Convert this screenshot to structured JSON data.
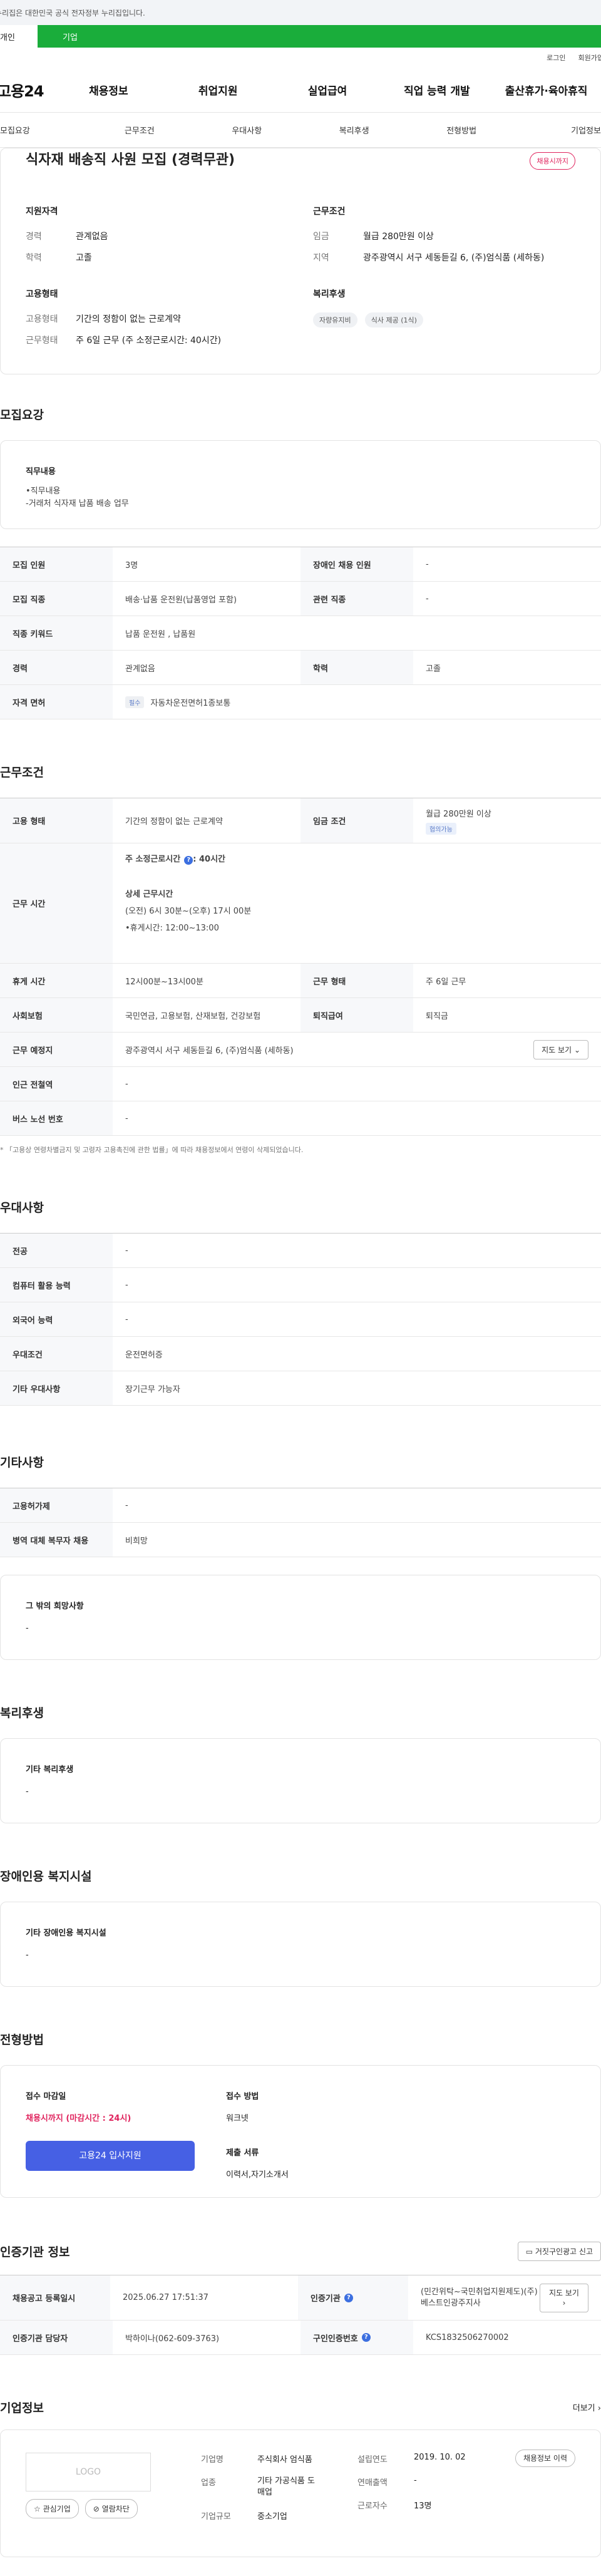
{
  "topbar": {
    "notice": "누리집은 대한민국 공식 전자정부 누리집입니다."
  },
  "tabs": {
    "person": "개인",
    "biz": "기업"
  },
  "util": {
    "login": "로그인",
    "join": "회원가입"
  },
  "gnb": {
    "logo": "고용24",
    "items": [
      "채용정보",
      "취업지원",
      "실업급여",
      "직업 능력 개발",
      "출산휴가·육아휴직"
    ]
  },
  "subnav": [
    "모집요강",
    "근무조건",
    "우대사항",
    "복리후생",
    "전형방법",
    "기업정보"
  ],
  "summary": {
    "title": "식자재 배송직 사원 모집 (경력무관)",
    "badge": "채용시까지",
    "qual": {
      "heading": "지원자격",
      "career_k": "경력",
      "career_v": "관계없음",
      "edu_k": "학력",
      "edu_v": "고졸"
    },
    "emp": {
      "heading": "고용형태",
      "type_k": "고용형태",
      "type_v": "기간의 정함이 없는 근로계약",
      "work_k": "근무형태",
      "work_v": "주 6일 근무 (주 소정근로시간: 40시간)"
    },
    "cond": {
      "heading": "근무조건",
      "wage_k": "임금",
      "wage_v": "월급 280만원 이상",
      "area_k": "지역",
      "area_v": "광주광역시 서구 세동듣길 6, (주)엄식품 (세하동)"
    },
    "welfare": {
      "heading": "복리후생",
      "chips": [
        "자량유지비",
        "식사 제공 (1식)"
      ]
    }
  },
  "recruit": {
    "heading": "모집요강",
    "job_heading": "직무내용",
    "job_lines": [
      "•직무내용",
      "-거래처 식자재 납품 배송 업무"
    ],
    "rows": {
      "count_k": "모집 인원",
      "count_v": "3명",
      "disabled_k": "장애인 채용 인원",
      "disabled_v": "-",
      "job_k": "모집 직종",
      "job_v": "배송·납품 운전원(납품영업 포함)",
      "rel_k": "관련 직종",
      "rel_v": "-",
      "kw_k": "직종 키워드",
      "kw_v": "납품 운전원 , 납품원",
      "career_k": "경력",
      "career_v": "관계없음",
      "edu_k": "학력",
      "edu_v": "고졸",
      "lic_k": "자격 면허",
      "lic_tag": "필수",
      "lic_v": "자동차운전면허1종보통"
    }
  },
  "work": {
    "heading": "근무조건",
    "type_k": "고용 형태",
    "type_v": "기간의 정함이 없는 근로계약",
    "wage_k": "임금 조건",
    "wage_v": "월급 280만원 이상",
    "wage_tag": "협의가능",
    "time_k": "근무 시간",
    "time_total": "주 소정근로시간",
    "time_hours": ": 40시간",
    "time_detail_h": "상세 근무시간",
    "time_detail_1": "(오전) 6시 30분~(오후) 17시 00분",
    "time_detail_2": "•휴게시간: 12:00~13:00",
    "rest_k": "휴게 시간",
    "rest_v": "12시00분~13시00분",
    "form_k": "근무 형태",
    "form_v": "주 6일 근무",
    "ins_k": "사회보험",
    "ins_v": "국민연금, 고용보험, 산재보험, 건강보험",
    "sev_k": "퇴직급여",
    "sev_v": "퇴직금",
    "place_k": "근무 예정지",
    "place_v": "광주광역시 서구 세동듣길 6, (주)엄식품 (세하동)",
    "map_btn": "지도 보기",
    "subway_k": "인근 전철역",
    "subway_v": "-",
    "bus_k": "버스 노선 번호",
    "bus_v": "-",
    "note": "* 「고용상 연령차별금지 및 고령자 고용촉진에 관한 법률」에 따라 채용정보에서 연령이 삭제되었습니다."
  },
  "pref": {
    "heading": "우대사항",
    "major_k": "전공",
    "major_v": "-",
    "pc_k": "컴퓨터 활용 능력",
    "pc_v": "-",
    "lang_k": "외국어 능력",
    "lang_v": "-",
    "cond_k": "우대조건",
    "cond_v": "운전면허증",
    "etc_k": "기타 우대사항",
    "etc_v": "장기근무 가능자"
  },
  "etc": {
    "heading": "기타사항",
    "permit_k": "고용허가제",
    "permit_v": "-",
    "mil_k": "병역 대체 복무자 채용",
    "mil_v": "비희망",
    "hope_h": "그 밖의 희망사항",
    "hope_v": "-"
  },
  "benefit": {
    "heading": "복리후생",
    "box_h": "기타 복리후생",
    "box_v": "-"
  },
  "facility": {
    "heading": "장애인용 복지시설",
    "box_h": "기타 장애인용 복지시설",
    "box_v": "-"
  },
  "process": {
    "heading": "전형방법",
    "deadline_h": "접수 마감일",
    "deadline_v": "채용시까지 (마감시간 : 24시)",
    "method_h": "접수 방법",
    "method_v": "워크넷",
    "docs_h": "제출 서류",
    "docs_v": "이력서,자기소개서",
    "apply_btn": "고용24 입사지원"
  },
  "agency": {
    "heading": "인증기관 정보",
    "report_btn": "거짓구인광고 신고",
    "reg_k": "채용공고 등록일시",
    "reg_v": "2025.06.27 17:51:37",
    "org_k": "인증기관",
    "org_v": "(민간위탁~국민취업지원제도)(주)베스트인광주지사",
    "map_btn": "지도 보기",
    "mgr_k": "인증기관 담당자",
    "mgr_v": "박하이나(062-609-3763)",
    "num_k": "구인인증번호",
    "num_v": "KCS1832506270002"
  },
  "company": {
    "heading": "기업정보",
    "more": "더보기",
    "logo_text": "LOGO",
    "fav_btn": "관심기업",
    "block_btn": "열람차단",
    "name_k": "기업명",
    "name_v": "주식회사 엄식품",
    "ind_k": "업종",
    "ind_v": "기타 가공식품 도매업",
    "size_k": "기업규모",
    "size_v": "중소기업",
    "est_k": "설립연도",
    "est_v": "2019. 10. 02",
    "sales_k": "연매출액",
    "sales_v": "-",
    "emp_k": "근로자수",
    "emp_v": "13명",
    "jobs_btn": "채용정보 이력"
  }
}
